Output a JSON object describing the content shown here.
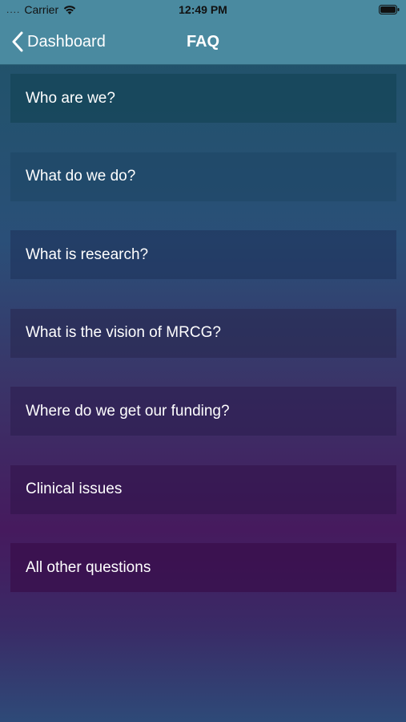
{
  "status_bar": {
    "signal_dots": "....",
    "carrier": "Carrier",
    "time": "12:49 PM",
    "icons": [
      "wifi-icon",
      "battery-icon"
    ]
  },
  "nav": {
    "back_label": "Dashboard",
    "back_icon": "chevron-left-icon",
    "title": "FAQ"
  },
  "faq": {
    "items": [
      {
        "label": "Who are we?"
      },
      {
        "label": "What do we do?"
      },
      {
        "label": "What is research?"
      },
      {
        "label": "What is the vision of MRCG?"
      },
      {
        "label": "Where do we get our funding?"
      },
      {
        "label": "Clinical issues"
      },
      {
        "label": "All other questions"
      }
    ]
  },
  "colors": {
    "nav_background": "#4a8aa0",
    "gradient_top": "#1e5466",
    "gradient_mid": "#461a5e",
    "gradient_bottom": "#2e4a78"
  }
}
